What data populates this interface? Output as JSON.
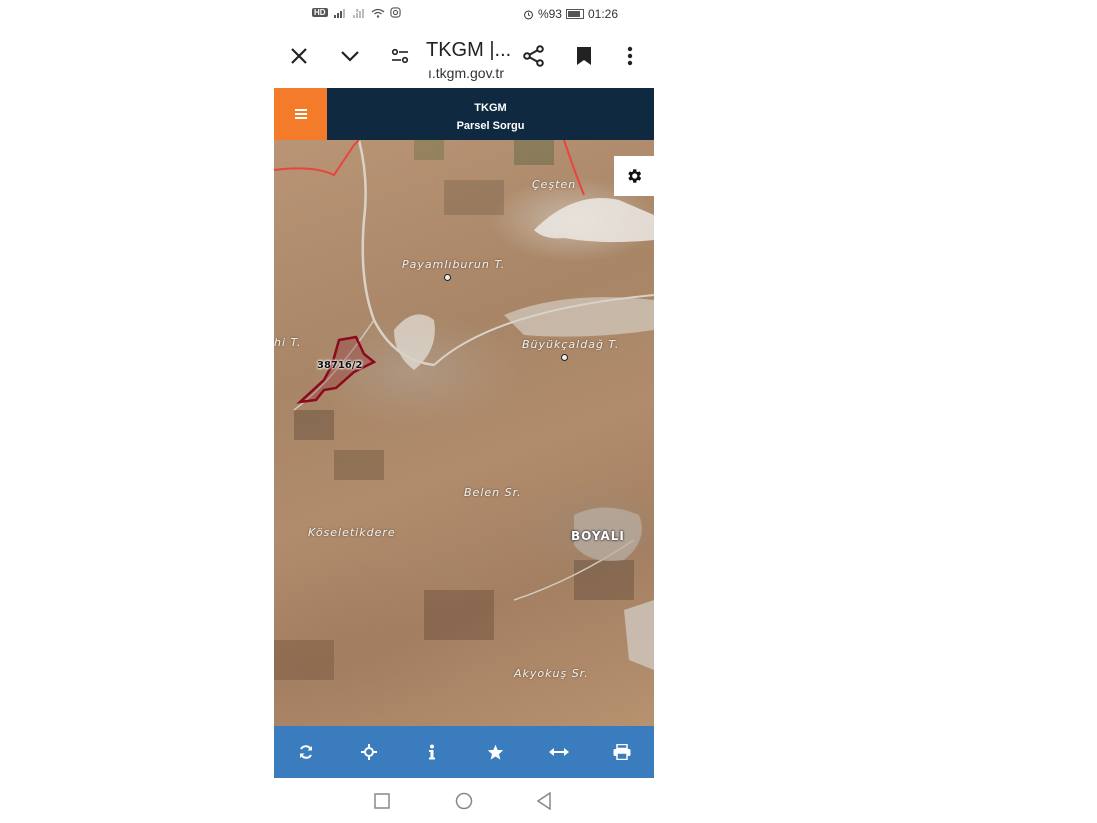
{
  "status_bar": {
    "battery": "%93",
    "time": "01:26",
    "hd_label": "HD",
    "icons": [
      "hd-voice-icon",
      "signal-icon",
      "signal-roaming-icon",
      "wifi-icon",
      "instagram-icon",
      "alarm-icon",
      "battery-icon"
    ]
  },
  "browser": {
    "title": "TKGM |...",
    "url": "ı.tkgm.gov.tr",
    "icons": [
      "close-icon",
      "chevron-down-icon",
      "site-settings-icon",
      "share-icon",
      "bookmark-icon",
      "more-vert-icon"
    ]
  },
  "app": {
    "brand": "TKGM",
    "subtitle": "Parsel Sorgu",
    "menu_icon": "hamburger-menu-icon",
    "accent": "#f47b2a",
    "header_bg": "#0f2a40"
  },
  "map": {
    "labels": {
      "cesten": "Çeşten",
      "payamliburun": "Payamlıburun T.",
      "buyukcaldag": "Büyükçaldağ T.",
      "hi_t": "hi T.",
      "belen": "Belen Sr.",
      "koseletikdere": "Köseletikdere",
      "boyali": "BOYALI",
      "akyokus": "Akyokuş Sr."
    },
    "parcel": {
      "label": "38716/2",
      "color": "#8b0a1e"
    },
    "boundary_color": "#e8453c",
    "settings_icon": "gear-icon"
  },
  "toolbar": {
    "bg": "#3a7cbd",
    "buttons": [
      "refresh-icon",
      "locate-crosshair-icon",
      "info-icon",
      "star-icon",
      "measure-arrows-icon",
      "print-icon"
    ]
  },
  "navbar": {
    "buttons": [
      "recent-apps-icon",
      "home-icon",
      "back-icon"
    ]
  }
}
